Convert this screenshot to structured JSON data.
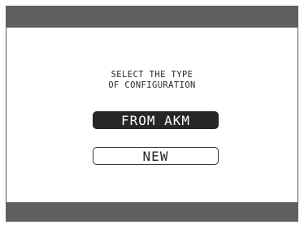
{
  "screen": {
    "prompt_line1": "SELECT THE TYPE",
    "prompt_line2": "OF CONFIGURATION",
    "options": [
      {
        "label": "FROM AKM",
        "selected": true
      },
      {
        "label": "NEW",
        "selected": false
      }
    ]
  },
  "colors": {
    "bar": "#5f5f5f",
    "selected_bg": "#262626",
    "selected_text": "#ffffff",
    "text": "#222222",
    "background": "#ffffff"
  }
}
